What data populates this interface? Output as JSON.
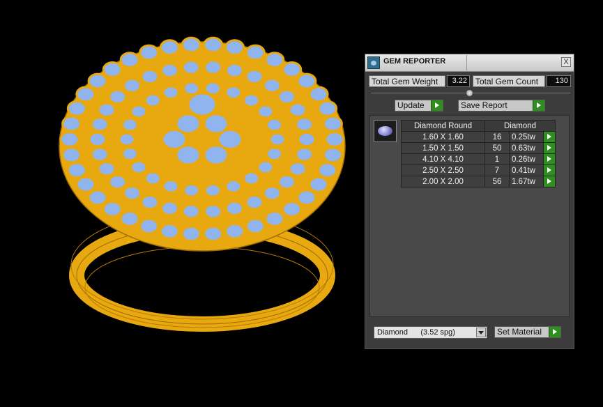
{
  "panel": {
    "title": "GEM REPORTER",
    "close_label": "X",
    "total_weight_label": "Total Gem Weight",
    "total_weight_value": "3.22",
    "total_count_label": "Total Gem Count",
    "total_count_value": "130",
    "update_label": "Update",
    "save_report_label": "Save Report",
    "table": {
      "col_shape": "Diamond Round",
      "col_material": "Diamond",
      "rows": [
        {
          "size": "1.60 X 1.60",
          "count": "16",
          "weight": "0.25tw"
        },
        {
          "size": "1.50 X 1.50",
          "count": "50",
          "weight": "0.63tw"
        },
        {
          "size": "4.10 X 4.10",
          "count": "1",
          "weight": "0.26tw"
        },
        {
          "size": "2.50 X 2.50",
          "count": "7",
          "weight": "0.41tw"
        },
        {
          "size": "2.00 X 2.00",
          "count": "56",
          "weight": "1.67tw"
        }
      ]
    },
    "material_select": "Diamond      (3.52 spg)",
    "set_material_label": "Set Material"
  },
  "colors": {
    "metal": "#e8a80f",
    "gem": "#8fb4ee",
    "background": "#000000",
    "accent_green": "#2e8f1f"
  }
}
